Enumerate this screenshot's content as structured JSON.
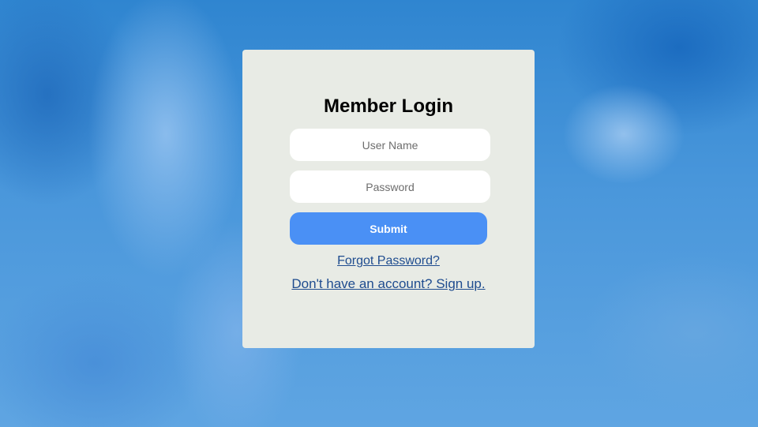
{
  "login": {
    "title": "Member Login",
    "username_placeholder": "User Name",
    "password_placeholder": "Password",
    "submit_label": "Submit",
    "forgot_password_link": "Forgot Password?",
    "signup_link": "Don't have an account? Sign up."
  },
  "colors": {
    "card_background": "#e8ebe5",
    "submit_button": "#4a90f5",
    "link": "#1f4c8f",
    "sky": "#4a97db"
  }
}
